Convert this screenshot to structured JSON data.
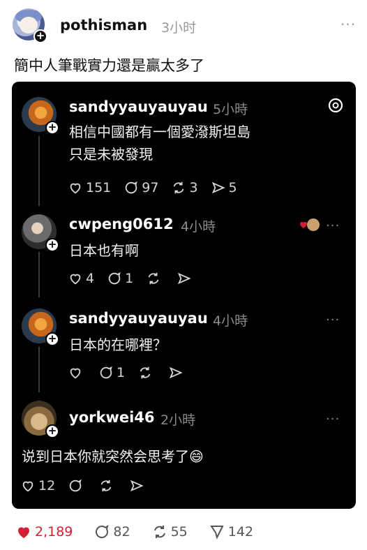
{
  "post": {
    "username": "pothisman",
    "time": "3小时",
    "text": "簡中人筆戰實力還是贏太多了",
    "more": "···"
  },
  "comments": [
    {
      "username": "sandyyauyauyau",
      "time": "5小時",
      "text": "相信中國都有一個愛潑斯坦島\n只是未被發現",
      "likes": "151",
      "replies": "97",
      "reposts": "3",
      "shares": "5"
    },
    {
      "username": "cwpeng0612",
      "time": "4小時",
      "text": "日本也有啊",
      "likes": "4",
      "replies": "1",
      "reposts": "",
      "shares": "",
      "more": "···"
    },
    {
      "username": "sandyyauyauyau",
      "time": "4小時",
      "text": "日本的在哪裡？",
      "likes": "",
      "replies": "1",
      "reposts": "",
      "shares": "",
      "more": "···"
    },
    {
      "username": "yorkwei46",
      "time": "2小時",
      "text": "说到日本你就突然会思考了😄",
      "likes": "12",
      "replies": "",
      "reposts": "",
      "shares": "",
      "more": "···"
    }
  ],
  "stats": {
    "likes": "2,189",
    "replies": "82",
    "reposts": "55",
    "shares": "142"
  },
  "colors": {
    "like_red": "#d11f35",
    "card_bg": "#000000",
    "muted_gray": "#999999"
  },
  "icons": [
    "plus-icon",
    "heart-icon",
    "comment-icon",
    "repost-icon",
    "share-icon",
    "threads-logo-icon",
    "more-icon",
    "emoji-icon"
  ]
}
